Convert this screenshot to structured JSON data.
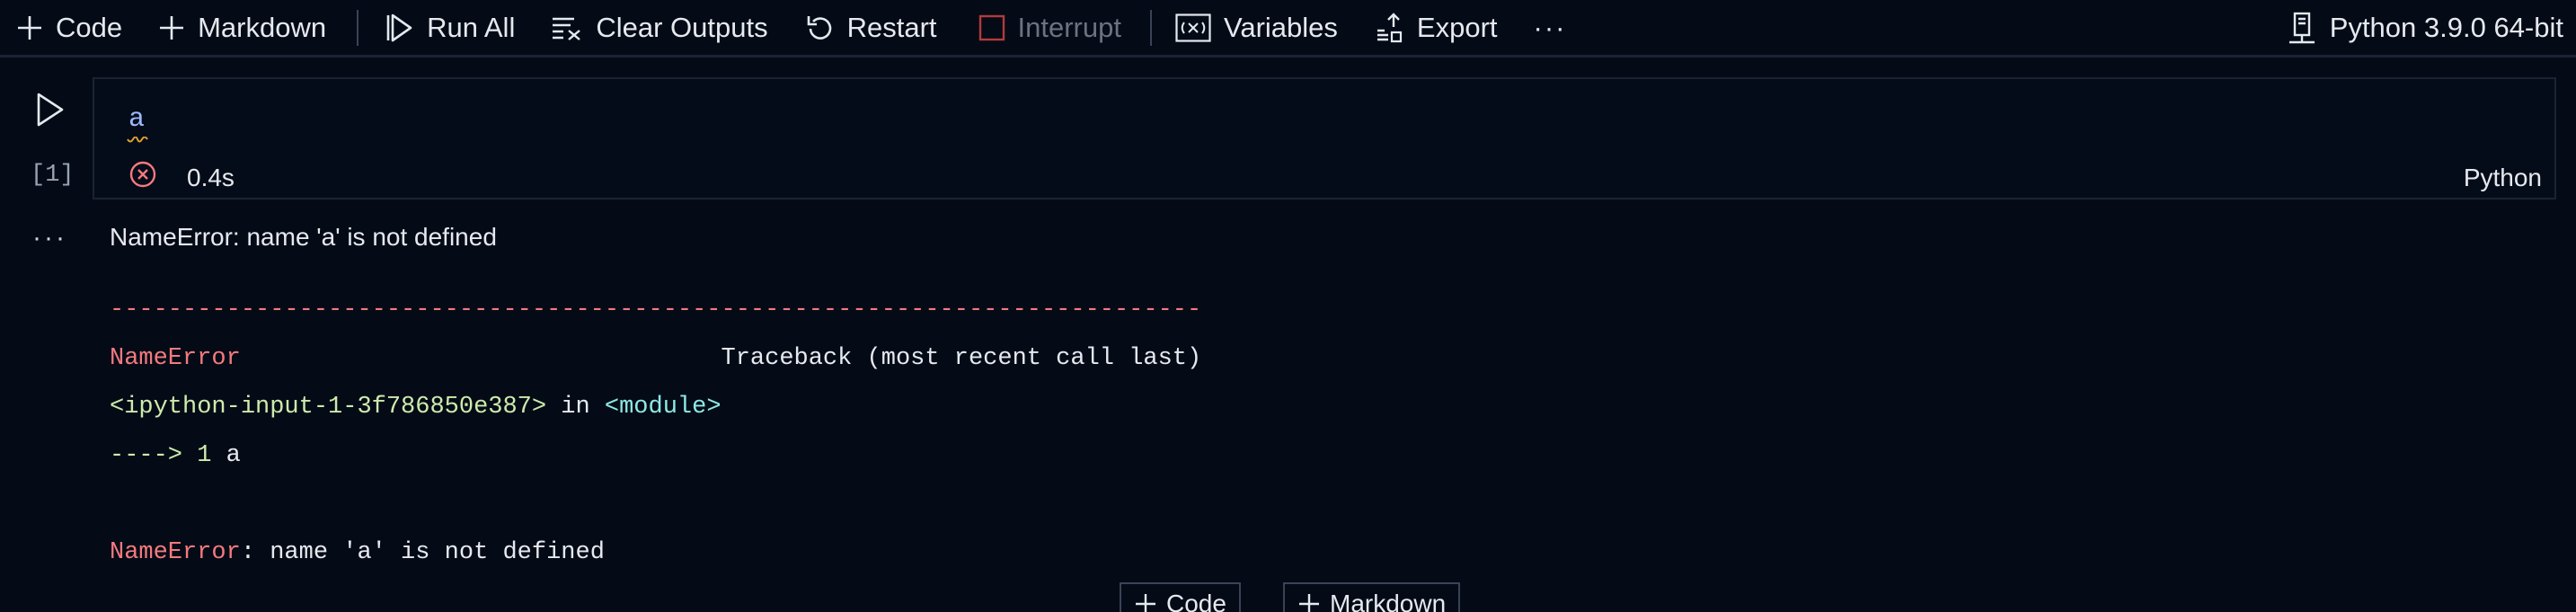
{
  "toolbar": {
    "code_label": "Code",
    "markdown_label": "Markdown",
    "run_all_label": "Run All",
    "clear_outputs_label": "Clear Outputs",
    "restart_label": "Restart",
    "interrupt_label": "Interrupt",
    "variables_label": "Variables",
    "export_label": "Export",
    "more_label": "···",
    "kernel_label": "Python 3.9.0 64-bit"
  },
  "cell": {
    "execution_count": "[1]",
    "source": "a",
    "status": "error",
    "duration": "0.4s",
    "language": "Python"
  },
  "output": {
    "more_label": "···",
    "summary": "NameError: name 'a' is not defined",
    "traceback": {
      "separator": "---------------------------------------------------------------------------",
      "error_name": "NameError",
      "traceback_header": "Traceback (most recent call last)",
      "input_ref": "<ipython-input-1-3f786850e387>",
      "in_text": " in ",
      "module_ref": "<module>",
      "arrow": "----> 1",
      "arrow_code": " a",
      "final_error_name": "NameError",
      "final_error_message": ": name 'a' is not defined"
    }
  },
  "add_cell": {
    "code_label": "Code",
    "markdown_label": "Markdown"
  },
  "colors": {
    "background": "#040b17",
    "error_red": "#f47a7e",
    "traceback_green": "#cdebac",
    "traceback_cyan": "#8ee9e6",
    "identifier_blue": "#9db8ff",
    "warning_squiggle": "#e0a030"
  }
}
